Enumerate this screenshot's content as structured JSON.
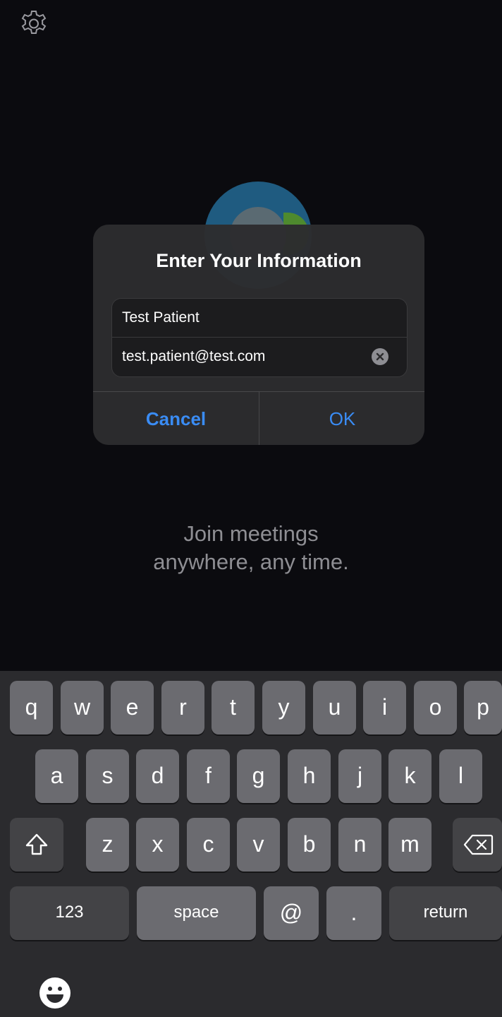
{
  "app": {
    "tagline_line1": "Join meetings",
    "tagline_line2": "anywhere, any time."
  },
  "dialog": {
    "title": "Enter Your Information",
    "name_value": "Test Patient",
    "email_value": "test.patient@test.com",
    "cancel_label": "Cancel",
    "ok_label": "OK"
  },
  "keyboard": {
    "row1": [
      "q",
      "w",
      "e",
      "r",
      "t",
      "y",
      "u",
      "i",
      "o",
      "p"
    ],
    "row2": [
      "a",
      "s",
      "d",
      "f",
      "g",
      "h",
      "j",
      "k",
      "l"
    ],
    "row3": [
      "z",
      "x",
      "c",
      "v",
      "b",
      "n",
      "m"
    ],
    "numbers_label": "123",
    "space_label": "space",
    "at_label": "@",
    "dot_label": ".",
    "return_label": "return"
  },
  "icons": {
    "settings": "gear-icon",
    "clear": "clear-circle-icon",
    "shift": "shift-icon",
    "delete": "delete-backspace-icon",
    "emoji": "emoji-icon"
  },
  "colors": {
    "accent": "#3a8cf4",
    "background": "#0b0b0f",
    "keyboard": "#2b2b2e",
    "key": "#6b6b70"
  }
}
